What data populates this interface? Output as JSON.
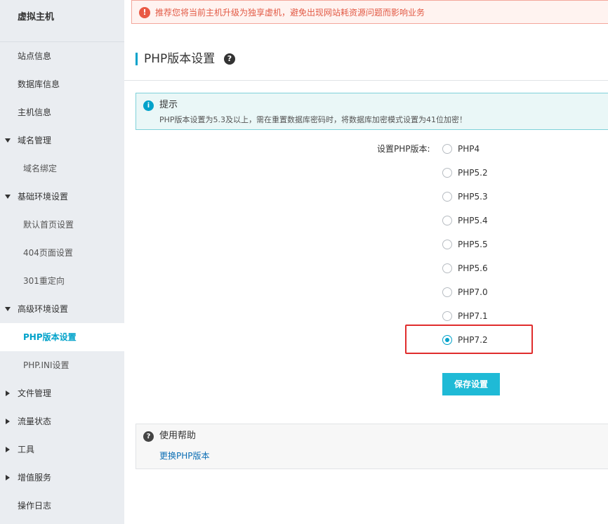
{
  "sidebar": {
    "title": "虚拟主机",
    "items": [
      {
        "label": "站点信息"
      },
      {
        "label": "数据库信息"
      },
      {
        "label": "主机信息"
      },
      {
        "label": "域名管理"
      },
      {
        "label": "域名绑定"
      },
      {
        "label": "基础环境设置"
      },
      {
        "label": "默认首页设置"
      },
      {
        "label": "404页面设置"
      },
      {
        "label": "301重定向"
      },
      {
        "label": "高级环境设置"
      },
      {
        "label": "PHP版本设置"
      },
      {
        "label": "PHP.INI设置"
      },
      {
        "label": "文件管理"
      },
      {
        "label": "流量状态"
      },
      {
        "label": "工具"
      },
      {
        "label": "增值服务"
      },
      {
        "label": "操作日志"
      }
    ]
  },
  "alert": {
    "icon": "!",
    "text": "推荐您将当前主机升级为独享虚机，避免出现网站耗资源问题而影响业务"
  },
  "page": {
    "title": "PHP版本设置",
    "help_icon": "?"
  },
  "tip": {
    "icon": "i",
    "title": "提示",
    "text": "PHP版本设置为5.3及以上，需在重置数据库密码时，将数据库加密模式设置为41位加密！"
  },
  "form": {
    "label": "设置PHP版本:",
    "options": [
      {
        "label": "PHP4"
      },
      {
        "label": "PHP5.2"
      },
      {
        "label": "PHP5.3"
      },
      {
        "label": "PHP5.4"
      },
      {
        "label": "PHP5.5"
      },
      {
        "label": "PHP5.6"
      },
      {
        "label": "PHP7.0"
      },
      {
        "label": "PHP7.1"
      },
      {
        "label": "PHP7.2"
      }
    ],
    "selected": "PHP7.2",
    "save_label": "保存设置"
  },
  "help": {
    "icon": "?",
    "title": "使用帮助",
    "link": "更换PHP版本"
  },
  "colors": {
    "accent": "#00a2ca",
    "button": "#1fbad6",
    "alert": "#e95a45",
    "highlight": "#e02d2d",
    "link": "#0b6eb4"
  }
}
